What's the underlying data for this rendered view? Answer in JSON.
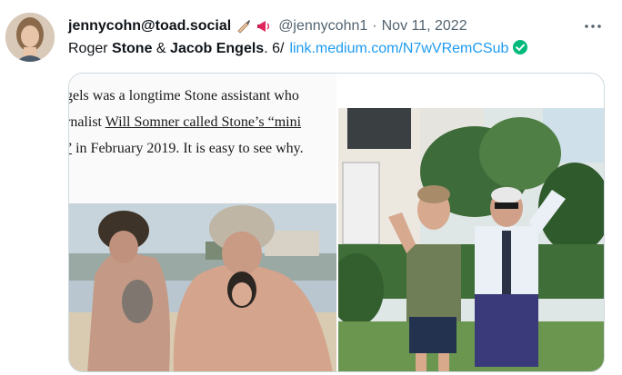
{
  "tweet": {
    "author_name": "jennycohn@toad.social",
    "emoji_icons": [
      "writing-hand-icon",
      "megaphone-icon"
    ],
    "handle": "@jennycohn1",
    "separator": "·",
    "date": "Nov 11, 2022",
    "text": {
      "part1": "Roger ",
      "bold1": "Stone",
      "part2": " & ",
      "bold2": "Jacob Engels",
      "part3": ". 6/",
      "link": "link.medium.com/N7wVRemCSub",
      "link_badge_icon": "verified-link-icon"
    },
    "more_icon": "more-options-icon"
  },
  "media": {
    "article_lines": {
      "line1": "gels was a longtime Stone assistant who",
      "line2_pre": "rnalist ",
      "line2_link": "Will Somner called Stone’s “mini",
      "line3_link": "”",
      "line3_post": " in February 2019. It is easy to see why."
    }
  },
  "colors": {
    "link": "#1d9bf0",
    "secondary_text": "#536471",
    "border": "#cfd9de",
    "verified": "#00ba7c"
  }
}
